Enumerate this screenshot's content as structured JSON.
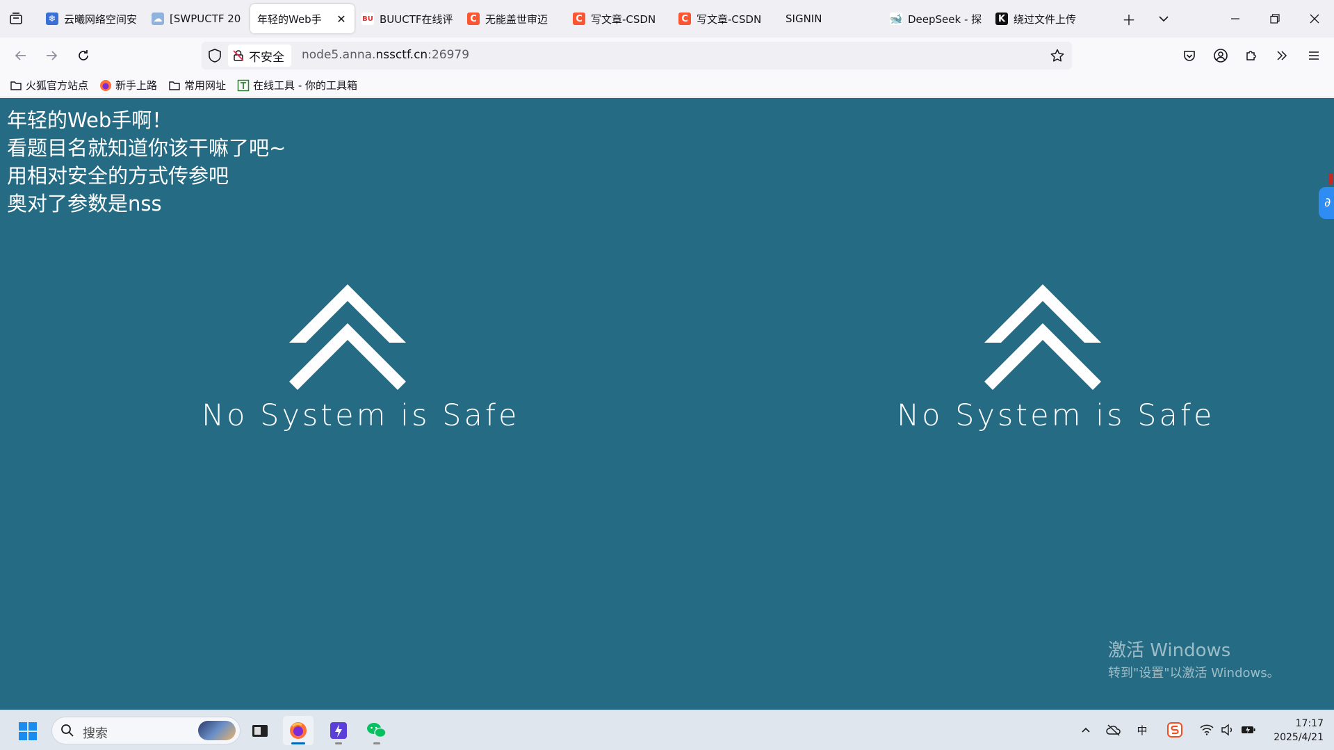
{
  "tabs": [
    {
      "title": "云曦网络空间安",
      "icon": "cloud-icon",
      "color": "#3a6fd8"
    },
    {
      "title": "[SWPUCTF 20",
      "icon": "ctf-icon",
      "color": "#5b8fc7"
    },
    {
      "title": "年轻的Web手",
      "icon": "",
      "color": "",
      "active": true
    },
    {
      "title": "BUUCTF在线评",
      "icon": "buu-icon",
      "color": "#d33"
    },
    {
      "title": "无能盖世审迈",
      "icon": "csdn-icon",
      "color": "#fc5531"
    },
    {
      "title": "写文章-CSDN",
      "icon": "csdn-icon",
      "color": "#fc5531"
    },
    {
      "title": "写文章-CSDN",
      "icon": "csdn-icon",
      "color": "#fc5531"
    },
    {
      "title": "SIGNIN",
      "icon": "",
      "color": ""
    },
    {
      "title": "DeepSeek - 探",
      "icon": "deepseek-icon",
      "color": "#4d6bfe"
    },
    {
      "title": "绕过文件上传",
      "icon": "k-icon",
      "color": "#111"
    }
  ],
  "navbar": {
    "insecure_label": "不安全",
    "url_prefix": "node5.anna.",
    "url_domain": "nssctf.cn",
    "url_suffix": ":26979"
  },
  "bookmarks": [
    {
      "label": "火狐官方站点",
      "icon": "folder-icon"
    },
    {
      "label": "新手上路",
      "icon": "firefox-icon"
    },
    {
      "label": "常用网址",
      "icon": "folder-icon"
    },
    {
      "label": "在线工具 - 你的工具箱",
      "icon": "tools-icon"
    }
  ],
  "page": {
    "lines": [
      "年轻的Web手啊！",
      "看题目名就知道你该干嘛了吧~",
      "用相对安全的方式传参吧",
      "奥对了参数是nss"
    ],
    "logo_text": "No System is Safe"
  },
  "activation": {
    "title": "激活 Windows",
    "subtitle": "转到\"设置\"以激活 Windows。"
  },
  "taskbar": {
    "search_placeholder": "搜索",
    "time": "17:17",
    "date": "2025/4/21",
    "ime": "中"
  }
}
